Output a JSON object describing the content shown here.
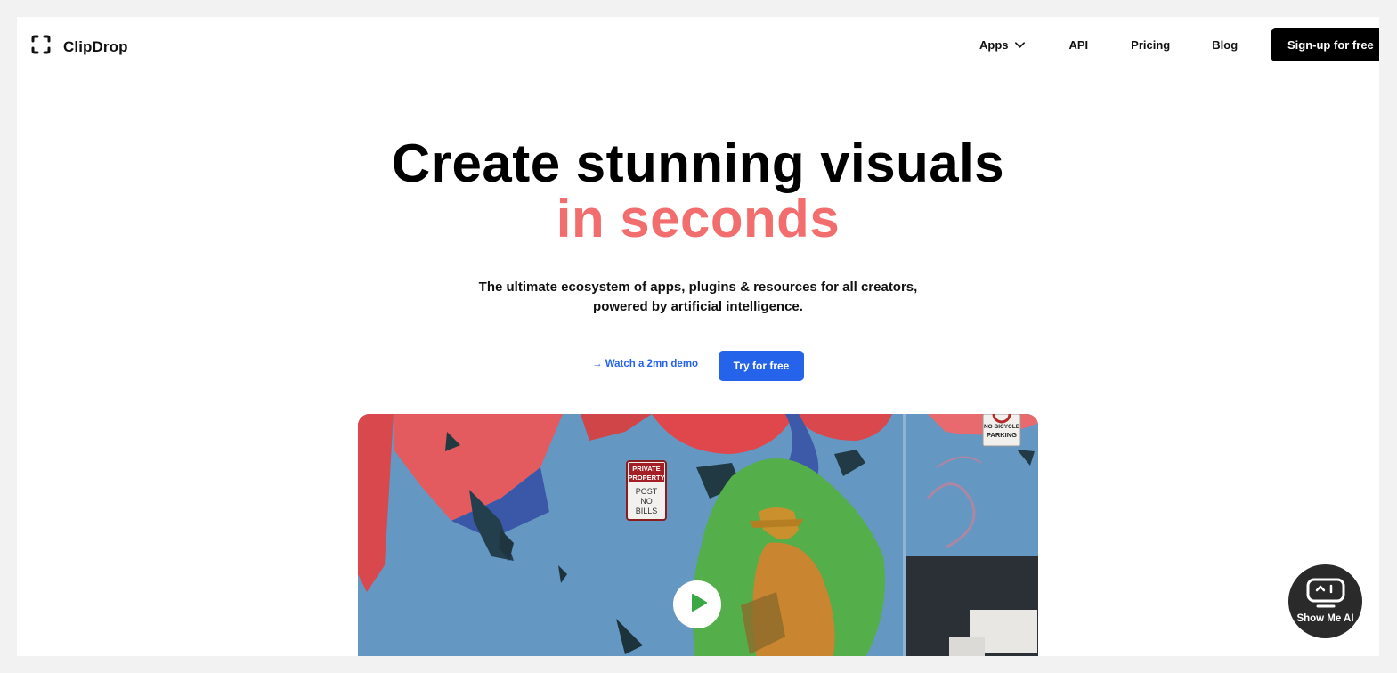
{
  "brand": {
    "name": "ClipDrop",
    "icon": "clipdrop-logo-icon"
  },
  "nav": {
    "apps": "Apps",
    "api": "API",
    "pricing": "Pricing",
    "blog": "Blog",
    "signup": "Sign-up for free"
  },
  "hero": {
    "title_line1": "Create stunning visuals",
    "title_line2": "in seconds",
    "subtitle_line1": "The ultimate ecosystem of apps, plugins & resources for all creators,",
    "subtitle_line2": "powered by artificial intelligence.",
    "demo_link": "→ Watch a 2mn demo",
    "try_button": "Try for free"
  },
  "video": {
    "sign_private": [
      "PRIVATE",
      "PROPERTY",
      "POST",
      "NO",
      "BILLS"
    ],
    "sign_bicycle": [
      "NO BICYCLE",
      "PARKING"
    ],
    "play_icon": "play-icon"
  },
  "widget": {
    "label": "Show Me AI",
    "icon": "robot-face-icon"
  },
  "colors": {
    "accent": "#2563eb",
    "highlight": "#f26d6d",
    "dark": "#000000"
  }
}
